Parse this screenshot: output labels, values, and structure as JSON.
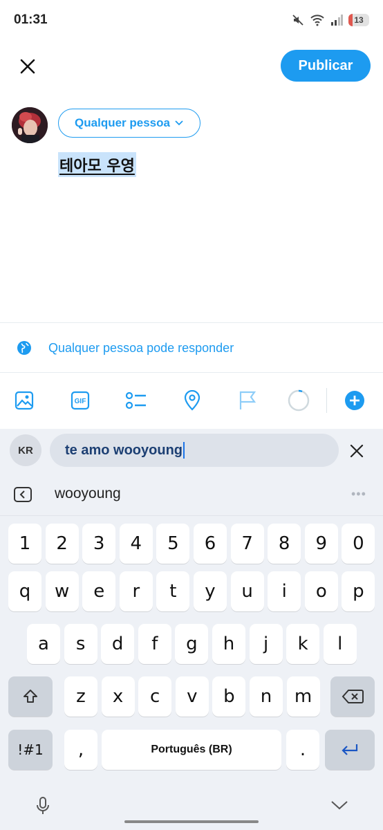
{
  "status_bar": {
    "time": "01:31",
    "battery": "13",
    "icons": [
      "mute-icon",
      "wifi-icon",
      "signal-icon",
      "battery-icon"
    ]
  },
  "header": {
    "close_icon": "close-icon",
    "publish_label": "Publicar"
  },
  "compose": {
    "audience_label": "Qualquer pessoa",
    "text": "테아모 우영 "
  },
  "reply_setting": {
    "label": "Qualquer pessoa pode responder",
    "icon": "globe-icon"
  },
  "toolbar": {
    "icons": [
      "image-icon",
      "gif-icon",
      "poll-icon",
      "location-icon",
      "flag-icon",
      "char-counter-ring",
      "add-icon"
    ],
    "gif_label": "GIF"
  },
  "translator": {
    "language_badge": "KR",
    "input_value": "te amo wooyoung",
    "suggestion": "wooyoung",
    "more": "•••"
  },
  "keyboard": {
    "row_numbers": [
      "1",
      "2",
      "3",
      "4",
      "5",
      "6",
      "7",
      "8",
      "9",
      "0"
    ],
    "row_1": [
      "q",
      "w",
      "e",
      "r",
      "t",
      "y",
      "u",
      "i",
      "o",
      "p"
    ],
    "row_2": [
      "a",
      "s",
      "d",
      "f",
      "g",
      "h",
      "j",
      "k",
      "l"
    ],
    "row_3": [
      "z",
      "x",
      "c",
      "v",
      "b",
      "n",
      "m"
    ],
    "symbols_label": "!#1",
    "comma": ",",
    "space_label": "Português (BR)",
    "period": "."
  },
  "colors": {
    "accent": "#1d9bf0",
    "keyboard_bg": "#eef1f6",
    "key_bg": "#ffffff",
    "func_key_bg": "#cdd3db",
    "selection": "#c9e3fb"
  }
}
